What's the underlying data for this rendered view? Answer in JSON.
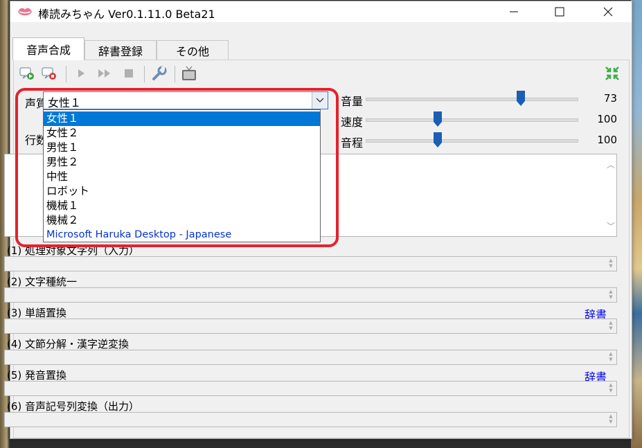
{
  "window": {
    "title": "棒読みちゃん Ver0.1.11.0 Beta21",
    "controls": {
      "minimize": "–",
      "maximize": "☐",
      "close": "✕"
    }
  },
  "tabs": [
    {
      "label": "音声合成",
      "active": true
    },
    {
      "label": "辞書登録",
      "active": false
    },
    {
      "label": "その他",
      "active": false
    }
  ],
  "toolbar": {
    "icons": [
      "play-add-icon",
      "play-stop-record-icon",
      "play-icon",
      "fast-forward-icon",
      "stop-icon",
      "wrench-icon",
      "tv-icon",
      "collapse-arrows-icon"
    ]
  },
  "voice": {
    "label": "声質",
    "selected": "女性１",
    "options": [
      "女性１",
      "女性２",
      "男性１",
      "男性２",
      "中性",
      "ロボット",
      "機械１",
      "機械２",
      "Microsoft Haruka Desktop - Japanese"
    ],
    "line_label": "行数"
  },
  "sliders": [
    {
      "label": "音量",
      "value": "73",
      "level": 0.73
    },
    {
      "label": "速度",
      "value": "100",
      "level": 0.34
    },
    {
      "label": "音程",
      "value": "100",
      "level": 0.34
    }
  ],
  "stages": [
    {
      "label": "(1) 処理対象文字列（入力）",
      "dict": ""
    },
    {
      "label": "(2) 文字種統一",
      "dict": ""
    },
    {
      "label": "(3) 単語置換",
      "dict": "辞書"
    },
    {
      "label": "(4) 文節分解・漢字逆変換",
      "dict": ""
    },
    {
      "label": "(5) 発音置換",
      "dict": "辞書"
    },
    {
      "label": "(6) 音声記号列変換（出力）",
      "dict": ""
    }
  ],
  "colors": {
    "highlight": "#e2222e",
    "selection": "#0078d7",
    "slider_thumb": "#1a5fb4",
    "link": "#0000ee"
  }
}
